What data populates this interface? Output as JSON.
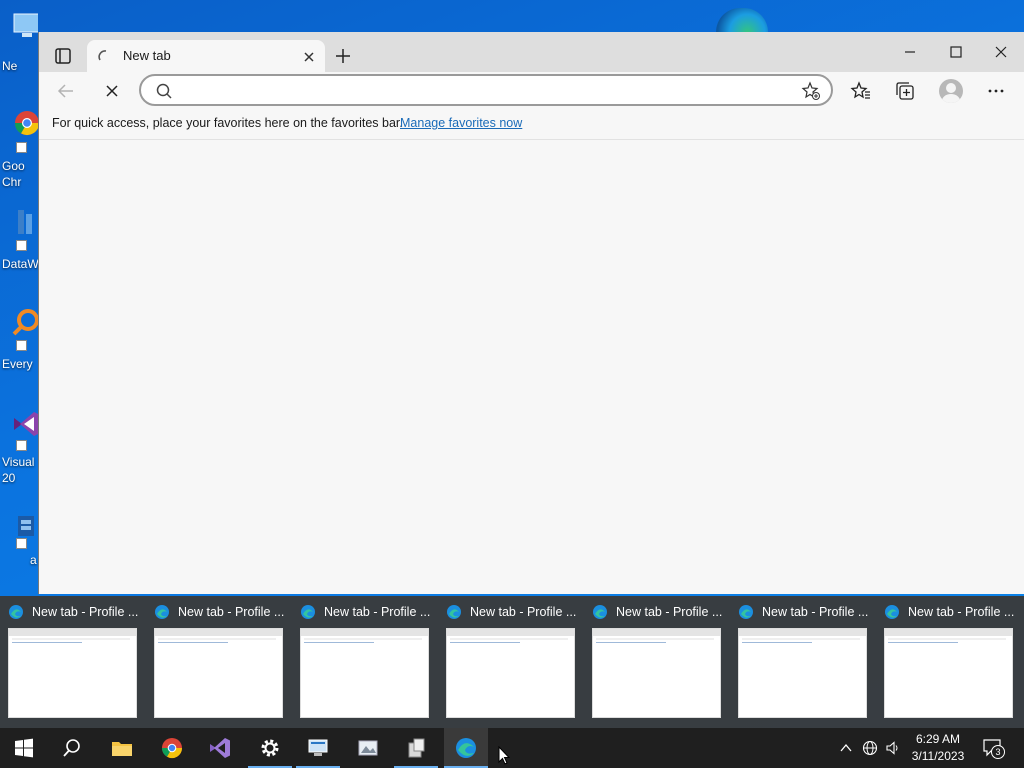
{
  "desktop": {
    "icons": [
      {
        "name": "new-folder",
        "label": "Ne"
      },
      {
        "name": "google-chrome",
        "label": "Goo\nChr"
      },
      {
        "name": "datawrapper",
        "label": "DataW"
      },
      {
        "name": "everything",
        "label": "Every"
      },
      {
        "name": "visual-studio",
        "label": "Visual\n20"
      },
      {
        "name": "app",
        "label": "a"
      }
    ]
  },
  "browser": {
    "tab": {
      "title": "New tab",
      "close_tip": "Close tab"
    },
    "address": {
      "value": "",
      "placeholder": ""
    },
    "favorites_bar": {
      "message": "For quick access, place your favorites here on the favorites bar.",
      "link": "Manage favorites now"
    }
  },
  "preview": {
    "windows": [
      {
        "title": "New tab - Profile ..."
      },
      {
        "title": "New tab - Profile ..."
      },
      {
        "title": "New tab - Profile ..."
      },
      {
        "title": "New tab - Profile ..."
      },
      {
        "title": "New tab - Profile ..."
      },
      {
        "title": "New tab - Profile ..."
      },
      {
        "title": "New tab - Profile ..."
      }
    ]
  },
  "taskbar": {
    "pinned": [
      "start-icon",
      "search-icon",
      "file-explorer-icon",
      "chrome-icon",
      "visual-studio-icon",
      "settings-icon",
      "remote-desktop-icon",
      "image-viewer-icon",
      "installer-icon",
      "edge-icon"
    ],
    "clock": {
      "time": "6:29 AM",
      "date": "3/11/2023"
    },
    "notifications": "3"
  },
  "colors": {
    "taskbar": "#1f1f1f",
    "accent": "#6ab0f1",
    "link": "#1a6bb8"
  }
}
